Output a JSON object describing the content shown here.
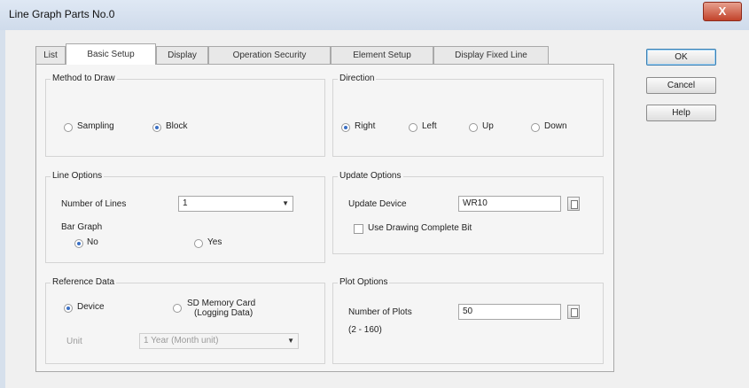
{
  "window": {
    "title": "Line Graph Parts No.0",
    "close_glyph": "X"
  },
  "tabs": [
    "List",
    "Basic Setup",
    "Display",
    "Operation Security",
    "Element Setup",
    "Display Fixed Line"
  ],
  "active_tab": "Basic Setup",
  "buttons": {
    "ok": "OK",
    "cancel": "Cancel",
    "help": "Help"
  },
  "method_to_draw": {
    "label": "Method to Draw",
    "options": [
      "Sampling",
      "Block"
    ],
    "selected": "Block"
  },
  "direction": {
    "label": "Direction",
    "options": [
      "Right",
      "Left",
      "Up",
      "Down"
    ],
    "selected": "Right"
  },
  "line_options": {
    "label": "Line Options",
    "number_of_lines_label": "Number of Lines",
    "number_of_lines_value": "1",
    "bar_graph_label": "Bar Graph",
    "bar_graph_options": [
      "No",
      "Yes"
    ],
    "bar_graph_selected": "No"
  },
  "update_options": {
    "label": "Update Options",
    "update_device_label": "Update Device",
    "update_device_value": "WR10",
    "use_drawing_complete_bit_label": "Use Drawing Complete Bit",
    "use_drawing_complete_bit_checked": false
  },
  "reference_data": {
    "label": "Reference Data",
    "options": [
      "Device",
      "SD Memory Card",
      "(Logging Data)"
    ],
    "selected": "Device",
    "unit_label": "Unit",
    "unit_value": "1 Year (Month unit)"
  },
  "plot_options": {
    "label": "Plot Options",
    "number_of_plots_label": "Number of Plots",
    "number_of_plots_value": "50",
    "range_hint": "(2 - 160)"
  },
  "colors": {
    "accent": "#3a6fc4",
    "close": "#c2432b",
    "title_bar": "#cfdbeb"
  }
}
